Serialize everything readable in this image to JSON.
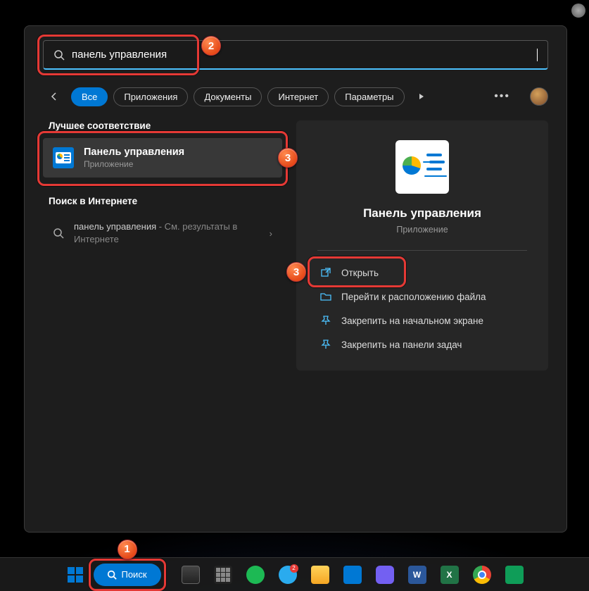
{
  "annotations": {
    "b1": "1",
    "b2": "2",
    "b3": "3"
  },
  "search": {
    "value": "панель управления"
  },
  "filters": {
    "all": "Все",
    "apps": "Приложения",
    "docs": "Документы",
    "web": "Интернет",
    "settings": "Параметры"
  },
  "left": {
    "best_label": "Лучшее соответствие",
    "result_title": "Панель управления",
    "result_sub": "Приложение",
    "web_label": "Поиск в Интернете",
    "web_q": "панель управления",
    "web_sub": " - См. результаты в Интернете"
  },
  "preview": {
    "title": "Панель управления",
    "sub": "Приложение",
    "open": "Открыть",
    "file_loc": "Перейти к расположению файла",
    "pin_start": "Закрепить на начальном экране",
    "pin_task": "Закрепить на панели задач"
  },
  "taskbar": {
    "search": "Поиск"
  }
}
